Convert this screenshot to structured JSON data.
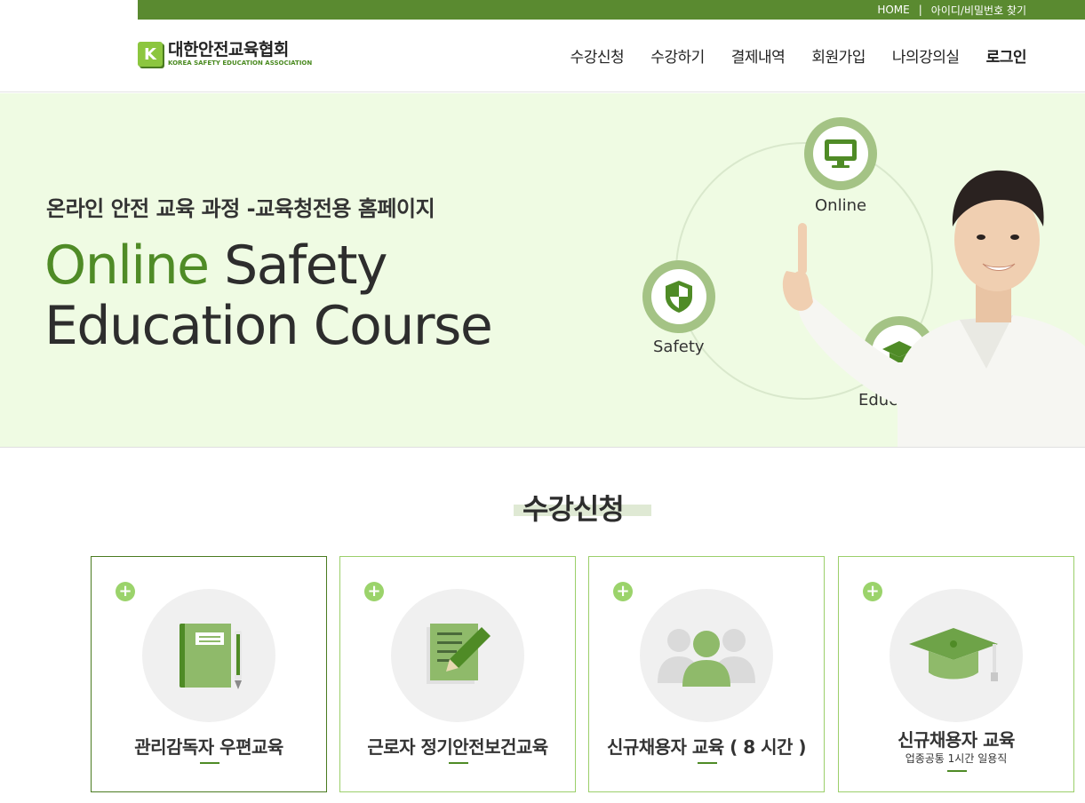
{
  "topbar": {
    "home_label": "HOME",
    "separator": "|",
    "find_account_label": "아이디/비밀번호 찾기"
  },
  "logo": {
    "letter": "K",
    "title": "대한안전교육협회",
    "subtitle": "KOREA SAFETY EDUCATION ASSOCIATION"
  },
  "nav": {
    "items": [
      "수강신청",
      "수강하기",
      "결제내역",
      "회원가입",
      "나의강의실",
      "로그인"
    ]
  },
  "hero": {
    "kicker": "온라인 안전 교육 과정 -교육청전용 홈페이지",
    "title_green": "Online",
    "title_rest": " Safety",
    "title_line2": "Education Course",
    "badges": {
      "online": "Online",
      "safety": "Safety",
      "education": "Education"
    }
  },
  "section": {
    "title": "수강신청"
  },
  "cards": [
    {
      "label": "관리감독자 우편교육",
      "sub": "",
      "icon": "notebook-icon"
    },
    {
      "label": "근로자 정기안전보건교육",
      "sub": "",
      "icon": "document-pen-icon"
    },
    {
      "label": "신규채용자 교육 ( 8 시간 )",
      "sub": "",
      "icon": "people-icon"
    },
    {
      "label": "신규채용자 교육",
      "sub": "업종공통 1시간 일용직",
      "icon": "graduation-cap-icon"
    }
  ],
  "colors": {
    "brand_green": "#5a8a30",
    "accent_green": "#4f8b26",
    "hero_bg": "#effbe3",
    "light_green": "#9bd36b"
  }
}
